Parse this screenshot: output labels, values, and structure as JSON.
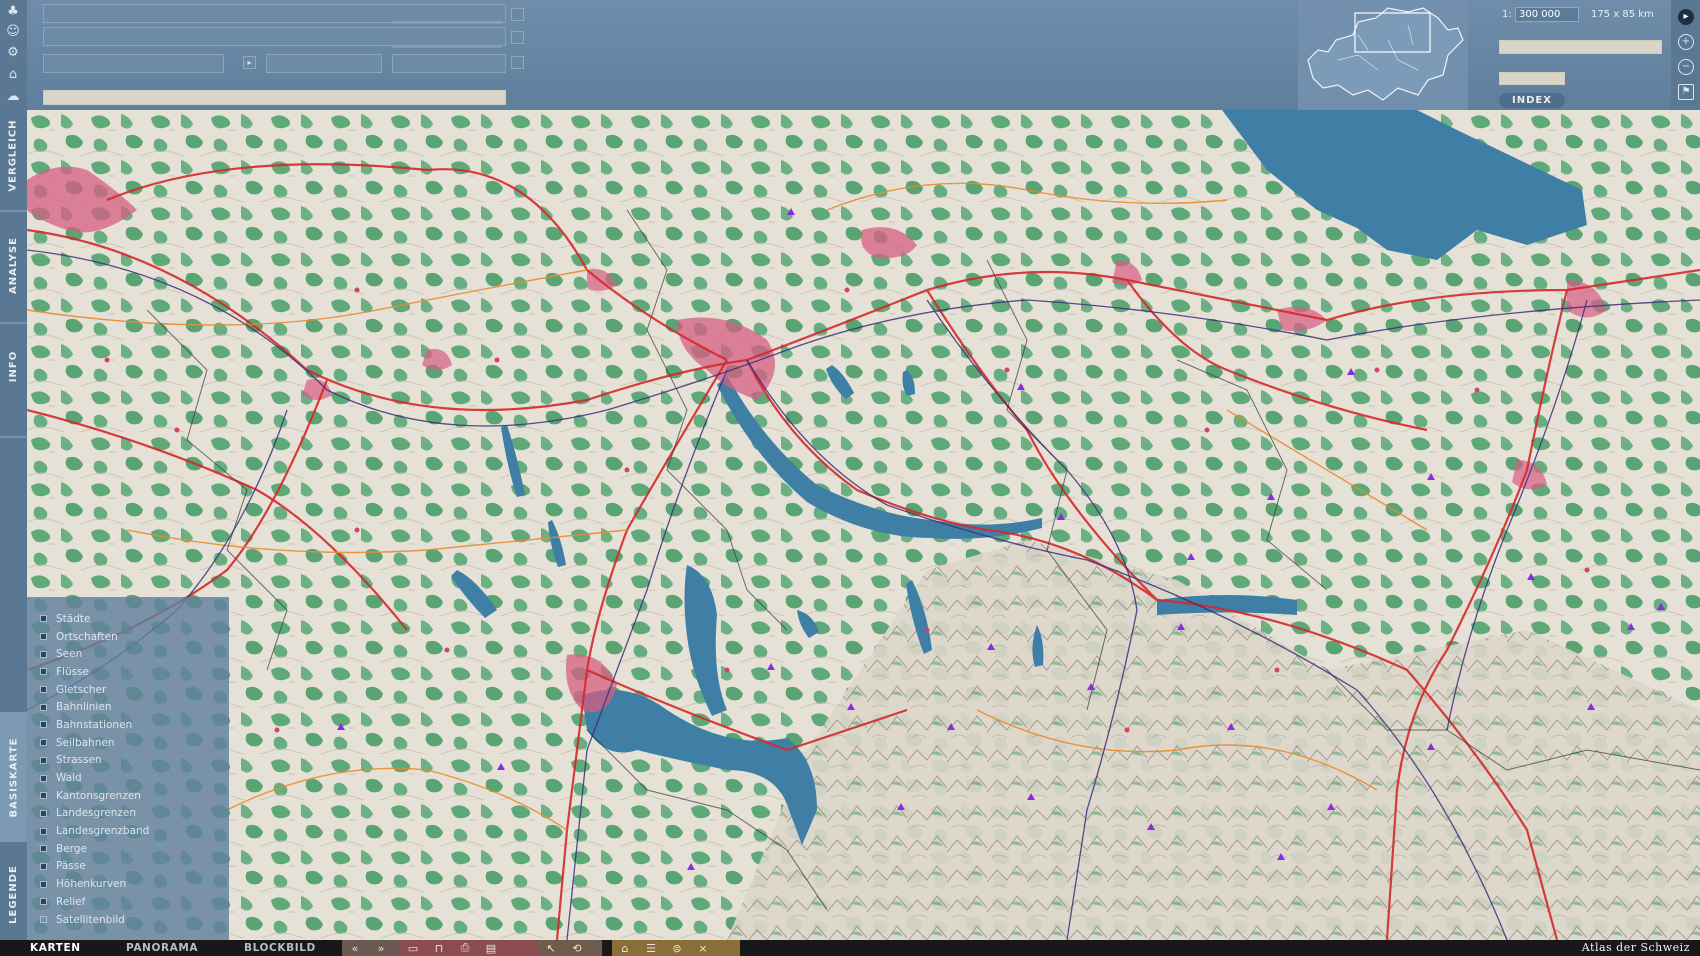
{
  "app": {
    "brand": "Atlas der Schweiz"
  },
  "side_tabs": [
    "VERGLEICH",
    "ANALYSE",
    "INFO",
    "BASISKARTE",
    "LEGENDE"
  ],
  "overview": {
    "scale_prefix": "1:",
    "scale_value": "300 000",
    "extent": "175 x 85 km",
    "index_button": "INDEX"
  },
  "legend": {
    "items": [
      {
        "label": "Städte",
        "on": true
      },
      {
        "label": "Ortschaften",
        "on": true
      },
      {
        "label": "Seen",
        "on": true
      },
      {
        "label": "Flüsse",
        "on": true
      },
      {
        "label": "Gletscher",
        "on": true
      },
      {
        "label": "Bahnlinien",
        "on": true
      },
      {
        "label": "Bahnstationen",
        "on": true
      },
      {
        "label": "Seilbahnen",
        "on": true
      },
      {
        "label": "Strassen",
        "on": true
      },
      {
        "label": "Wald",
        "on": true
      },
      {
        "label": "Kantonsgrenzen",
        "on": true
      },
      {
        "label": "Landesgrenzen",
        "on": true
      },
      {
        "label": "Landesgrenzband",
        "on": true
      },
      {
        "label": "Berge",
        "on": true
      },
      {
        "label": "Pässe",
        "on": true
      },
      {
        "label": "Höhenkurven",
        "on": true
      },
      {
        "label": "Relief",
        "on": true
      },
      {
        "label": "Satellitenbild",
        "on": false
      }
    ]
  },
  "bottom_tabs": [
    {
      "label": "KARTEN",
      "active": true
    },
    {
      "label": "PANORAMA",
      "active": false
    },
    {
      "label": "BLOCKBILD",
      "active": false
    }
  ],
  "colors": {
    "water": "#3f7fa6",
    "forest": "#5fa979",
    "roads": "#d42a2a",
    "rail": "#3a2f7a",
    "settlement": "#d75d83",
    "relief": "#e9e5dc"
  },
  "tool_icons": [
    "tree-icon",
    "people-icon",
    "gear-icon",
    "building-icon",
    "cloud-icon"
  ]
}
